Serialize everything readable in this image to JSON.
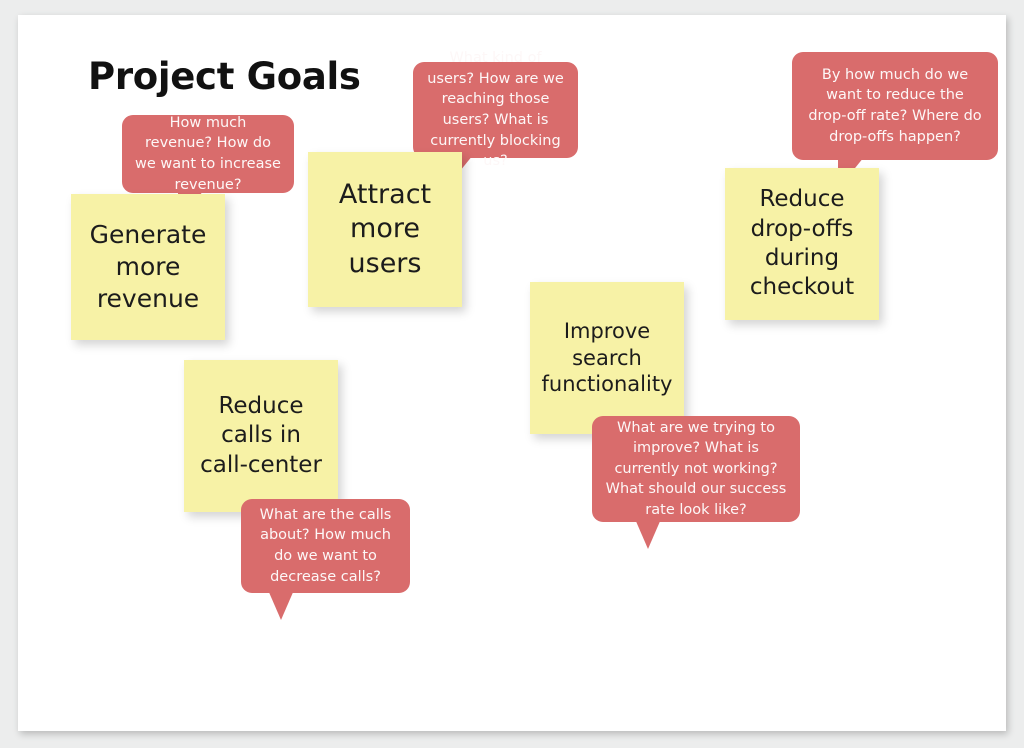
{
  "board": {
    "title": "Project Goals",
    "background_color": "#ffffff",
    "page_background_color": "#eceded"
  },
  "colors": {
    "sticky_note": "#f7f2a6",
    "callout": "#d96c6c",
    "callout_text": "#fdf7f7",
    "note_text": "#1c1c1c",
    "title_text": "#111111"
  },
  "notes": [
    {
      "id": "generate-more-revenue",
      "text": "Generate\nmore\nrevenue"
    },
    {
      "id": "attract-more-users",
      "text": "Attract\nmore\nusers"
    },
    {
      "id": "reduce-drop-offs-during-checkout",
      "text": "Reduce\ndrop-offs\nduring\ncheckout"
    },
    {
      "id": "improve-search-functionality",
      "text": "Improve\nsearch\nfunctionality"
    },
    {
      "id": "reduce-calls-in-call-center",
      "text": "Reduce\ncalls in\ncall-center"
    }
  ],
  "callouts": [
    {
      "id": "revenue-questions",
      "text": "How much revenue? How do we want to increase revenue?"
    },
    {
      "id": "users-questions",
      "text": "What kind of users? How are we reaching those users? What is currently blocking us?"
    },
    {
      "id": "drop-off-questions",
      "text": "By how much do we want to reduce the drop-off rate? Where do drop-offs happen?"
    },
    {
      "id": "search-questions",
      "text": "What are we trying to improve? What is currently not working? What should our success rate look like?"
    },
    {
      "id": "calls-questions",
      "text": "What are the calls about? How much do we want to decrease calls?"
    }
  ]
}
